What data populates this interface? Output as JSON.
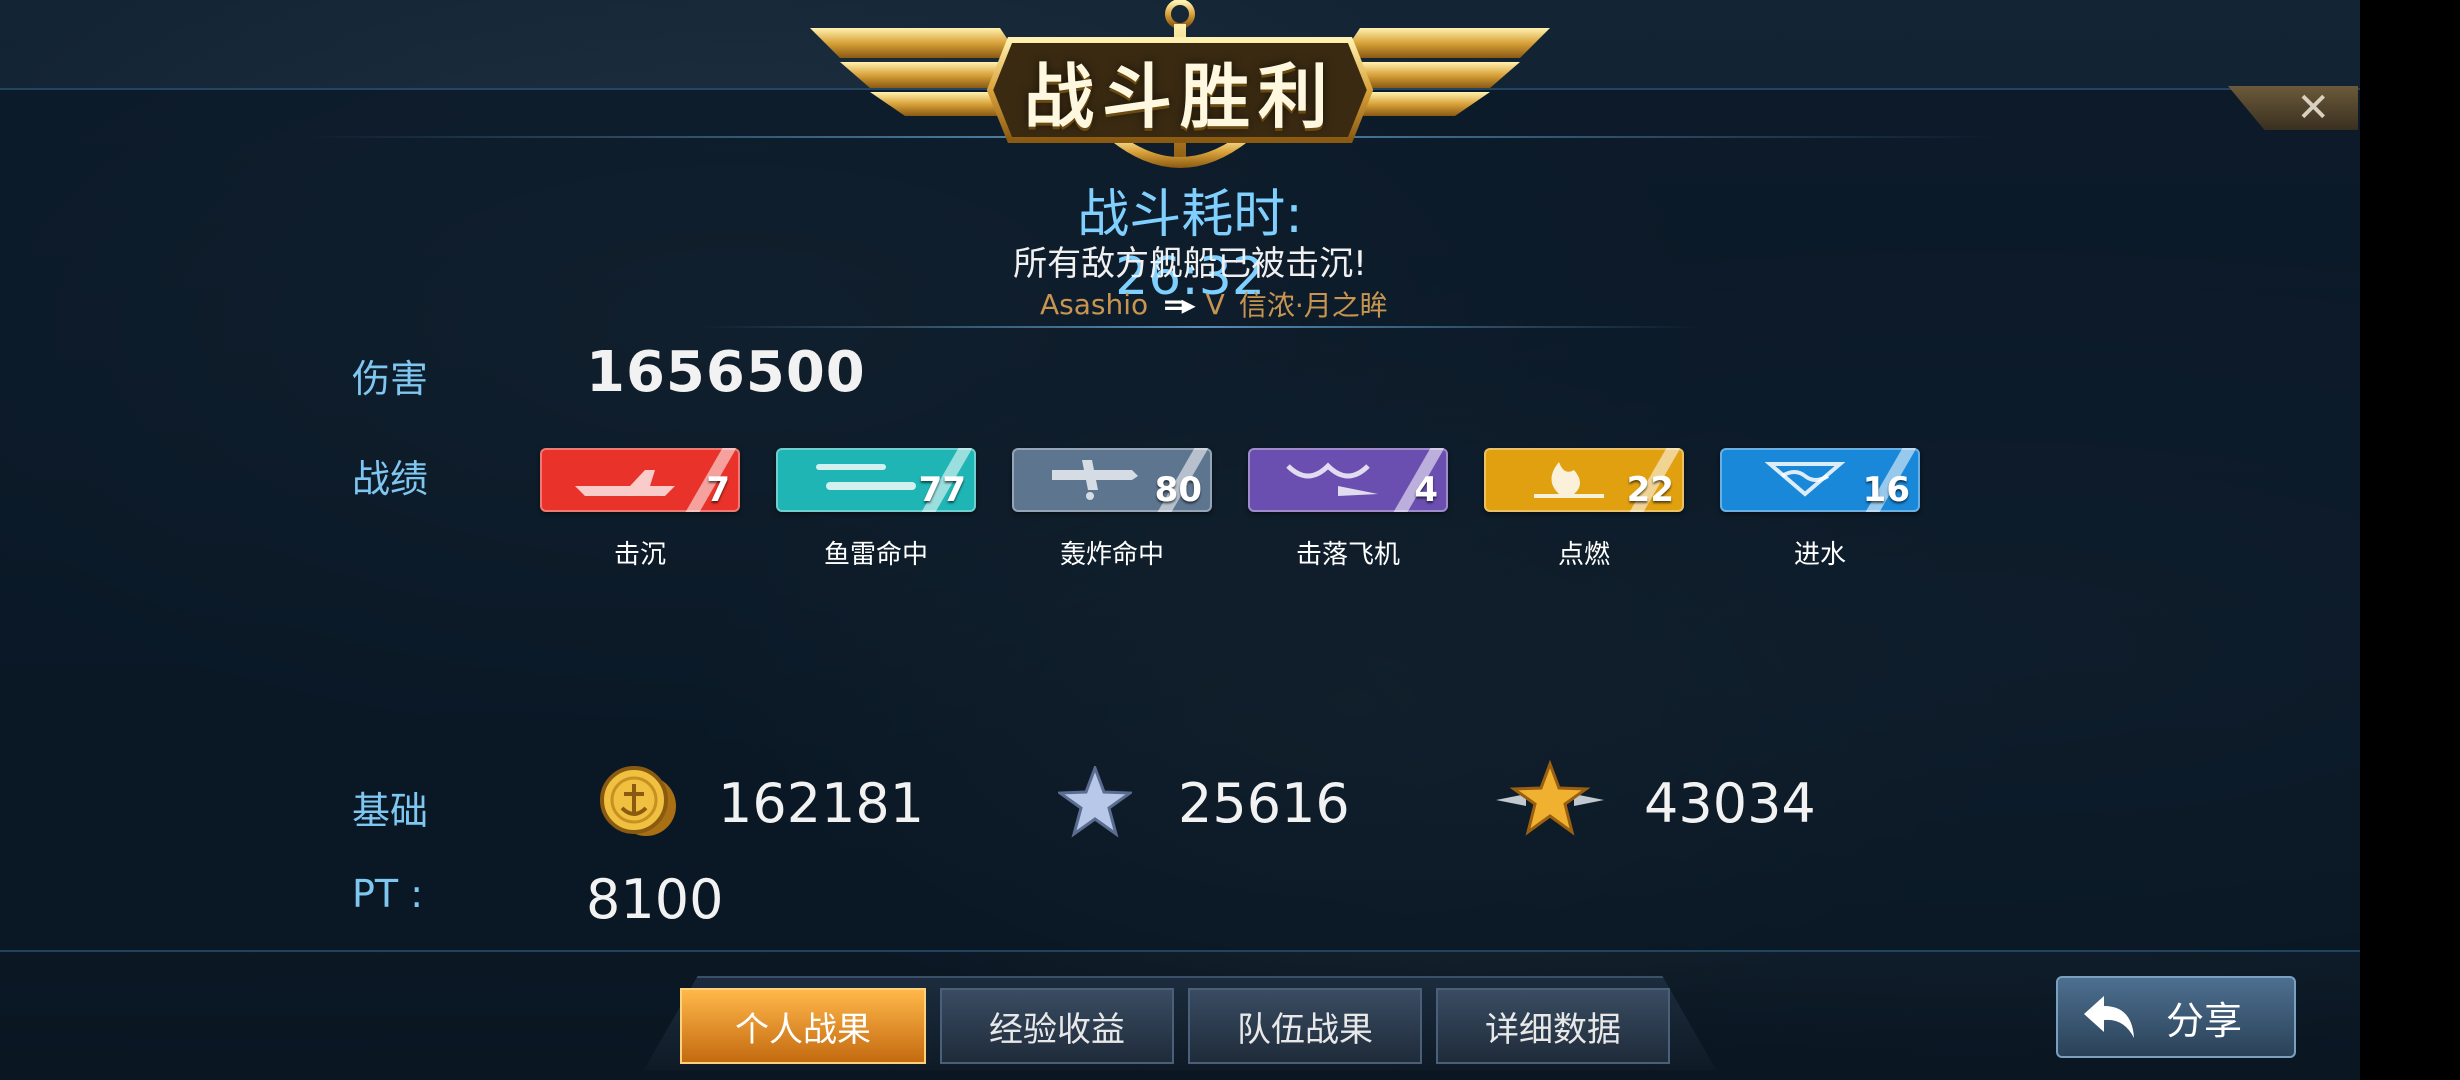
{
  "header": {
    "title": "战斗胜利",
    "duration_label": "战斗耗时:",
    "duration_value": "26:32",
    "subtitle": "所有敌方舰船已被击沉!",
    "player_left": "Asashio",
    "vs": "V",
    "player_right": "信浓·月之眸"
  },
  "damage": {
    "label": "伤害",
    "value": "1656500"
  },
  "record": {
    "label": "战绩",
    "stats": [
      {
        "label": "击沉",
        "value": "7",
        "color": "#e8322a",
        "icon": "ship-sinking-icon"
      },
      {
        "label": "鱼雷命中",
        "value": "77",
        "color": "#1fb5b5",
        "icon": "torpedo-icon"
      },
      {
        "label": "轰炸命中",
        "value": "80",
        "color": "#5e7590",
        "icon": "bomber-plane-icon"
      },
      {
        "label": "击落飞机",
        "value": "4",
        "color": "#6a4fb0",
        "icon": "shot-down-plane-icon"
      },
      {
        "label": "点燃",
        "value": "22",
        "color": "#e0a010",
        "icon": "fire-icon"
      },
      {
        "label": "进水",
        "value": "16",
        "color": "#1a88d8",
        "icon": "flooding-icon"
      }
    ]
  },
  "base": {
    "label": "基础",
    "coins": "162181",
    "exp": "25616",
    "rank_exp": "43034"
  },
  "pt": {
    "label": "PT :",
    "value": "8100"
  },
  "tabs": [
    {
      "label": "个人战果",
      "active": true
    },
    {
      "label": "经验收益",
      "active": false
    },
    {
      "label": "队伍战果",
      "active": false
    },
    {
      "label": "详细数据",
      "active": false
    }
  ],
  "share": {
    "label": "分享"
  },
  "close": {
    "label": "✕"
  }
}
